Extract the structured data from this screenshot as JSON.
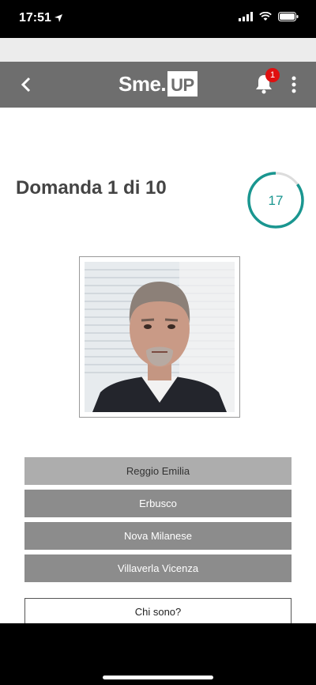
{
  "status": {
    "time": "17:51"
  },
  "header": {
    "logo_text": "Sme.",
    "logo_box": "UP",
    "notification_count": "1"
  },
  "question": {
    "title": "Domanda 1 di 10",
    "timer_value": "17",
    "timer_fraction": 0.85
  },
  "answers": [
    {
      "label": "Reggio Emilia"
    },
    {
      "label": "Erbusco"
    },
    {
      "label": "Nova Milanese"
    },
    {
      "label": "Villaverla Vicenza"
    }
  ],
  "who_button": "Chi sono?",
  "colors": {
    "header": "#6e6e6e",
    "timer": "#1a9690",
    "badge": "#e01010"
  }
}
